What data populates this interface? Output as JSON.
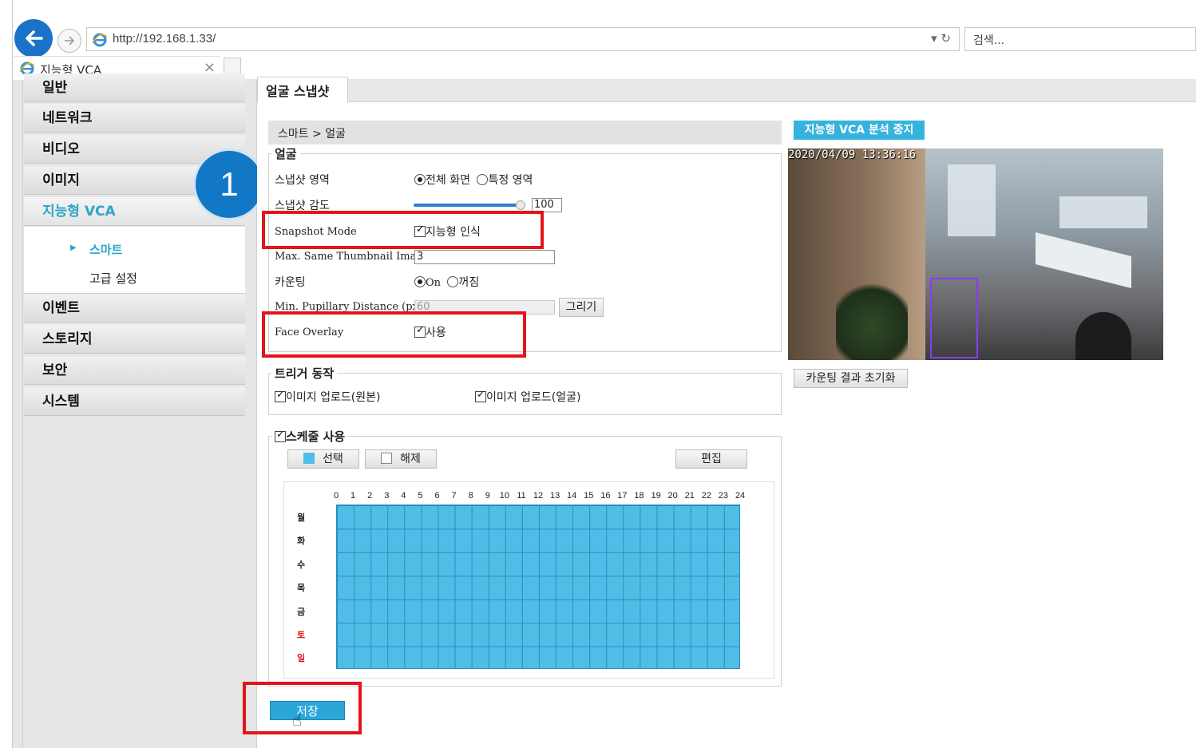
{
  "browser": {
    "url": "http://192.168.1.33/",
    "search_placeholder": "검색...",
    "tab_title": "지능형 VCA",
    "tab_close": "×"
  },
  "sidebar": {
    "items": [
      {
        "label": "일반"
      },
      {
        "label": "네트워크"
      },
      {
        "label": "비디오"
      },
      {
        "label": "이미지"
      },
      {
        "label": "지능형 VCA"
      },
      {
        "label": "이벤트"
      },
      {
        "label": "스토리지"
      },
      {
        "label": "보안"
      },
      {
        "label": "시스템"
      }
    ],
    "sub_items": [
      {
        "label": "스마트"
      },
      {
        "label": "고급 설정"
      }
    ]
  },
  "step_badge": "1",
  "page": {
    "tab": "얼굴 스냅샷",
    "breadcrumb": "스마트 > 얼굴"
  },
  "face_section": {
    "legend": "얼굴",
    "snapshot_area_label": "스냅샷 영역",
    "snapshot_area_opt1": "전체 화면",
    "snapshot_area_opt2": "특정 영역",
    "sensitivity_label": "스냅샷 감도",
    "sensitivity_value": "100",
    "snapshot_mode_label": "Snapshot Mode",
    "snapshot_mode_value": "지능형 인식",
    "max_thumb_label": "Max. Same Thumbnail Images",
    "max_thumb_value": "3",
    "counting_label": "카운팅",
    "counting_on": "On",
    "counting_off": "꺼짐",
    "min_pupil_label": "Min. Pupillary Distance (px)",
    "min_pupil_value": "60",
    "draw_button": "그리기",
    "face_overlay_label": "Face Overlay",
    "face_overlay_value": "사용"
  },
  "trigger_section": {
    "legend": "트리거 동작",
    "opt1": "이미지 업로드(원본)",
    "opt2": "이미지 업로드(얼굴)"
  },
  "schedule": {
    "legend": "스케줄 사용",
    "select_button": "선택",
    "clear_button": "해제",
    "edit_button": "편집",
    "hours": [
      "0",
      "1",
      "2",
      "3",
      "4",
      "5",
      "6",
      "7",
      "8",
      "9",
      "10",
      "11",
      "12",
      "13",
      "14",
      "15",
      "16",
      "17",
      "18",
      "19",
      "20",
      "21",
      "22",
      "23",
      "24"
    ],
    "days": [
      "월",
      "화",
      "수",
      "목",
      "금",
      "토",
      "일"
    ],
    "select_color": "#50bde6"
  },
  "video": {
    "stop_button": "지능형 VCA 분석 중지",
    "timestamp": "2020/04/09  13:36:16",
    "reset_button": "카운팅 결과 초기화"
  },
  "save_button": "저장",
  "colors": {
    "accent": "#2aa6c9",
    "highlight": "#e3141a",
    "badge": "#1278c5"
  }
}
